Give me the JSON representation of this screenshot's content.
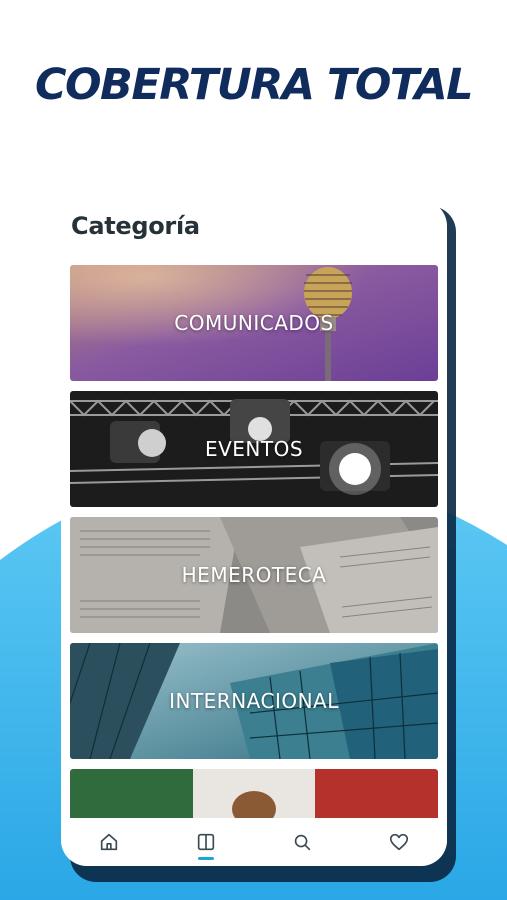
{
  "promo": {
    "headline": "COBERTURA TOTAL",
    "headline_color": "#0f2c5c",
    "wave_color": "#35b6ec"
  },
  "screen": {
    "title": "Categoría"
  },
  "categories": [
    {
      "label": "COMUNICADOS",
      "image": "microphone-photo"
    },
    {
      "label": "EVENTOS",
      "image": "stage-lights-photo"
    },
    {
      "label": "HEMEROTECA",
      "image": "newspapers-photo"
    },
    {
      "label": "INTERNACIONAL",
      "image": "glass-buildings-photo"
    },
    {
      "label": "",
      "image": "mexico-flag-photo"
    }
  ],
  "bottom_nav": {
    "items": [
      {
        "icon": "home-icon"
      },
      {
        "icon": "book-icon",
        "active": true
      },
      {
        "icon": "search-icon"
      },
      {
        "icon": "heart-icon"
      }
    ],
    "active_color": "#1aa6d8",
    "icon_color": "#3a4a52"
  }
}
